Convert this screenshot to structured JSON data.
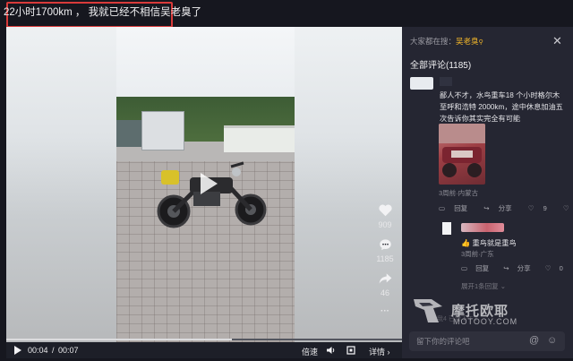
{
  "caption": "22小时1700km ， 我就已经不相信吴老臭了",
  "video": {
    "current_time": "00:04",
    "separator": "/",
    "total_time": "00:07",
    "progress_fraction": 0.57,
    "speed_label": "倍速",
    "detail_label": "详情",
    "detail_arrow": "›"
  },
  "actions": {
    "likes": "909",
    "comments": "1185",
    "shares": "46",
    "more": "···"
  },
  "panel": {
    "searching_prefix": "大家都在搜：",
    "searching_term": "吴老臭",
    "close": "✕",
    "comment_count_label": "全部评论(1185)"
  },
  "comments": [
    {
      "text": "鄙人不才，水鸟重车18 个小时格尔木至呼和浩特 2000km，途中休息加油五次告诉你其实完全有可能",
      "meta": "3周前·内蒙古",
      "reply": "回复",
      "share": "分享",
      "likes": "9"
    },
    {
      "badge": "👍",
      "text": "重鸟就是重鸟",
      "meta": "3周前·广东",
      "reply": "回复",
      "share": "分享",
      "likes": "0"
    }
  ],
  "expand_replies": "展开1条回复 ⌄",
  "watermark": {
    "cn": "摩托欧耶",
    "en": "MOTOOY.COM"
  },
  "faded_text": "我4  已错下午3",
  "input": {
    "placeholder": "留下你的评论吧",
    "at_icon": "@",
    "emoji_icon": "☺"
  }
}
